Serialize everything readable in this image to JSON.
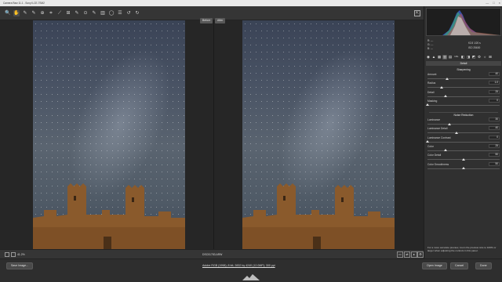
{
  "window": {
    "title": "Camera Raw 11.1  -  Sony ILCE-7SM2",
    "controls": [
      "—",
      "□",
      "×"
    ]
  },
  "toolbar": {
    "tools": [
      {
        "name": "zoom-tool",
        "glyph": "🔍",
        "active": false
      },
      {
        "name": "hand-tool",
        "glyph": "✋",
        "active": true
      },
      {
        "name": "white-balance-tool",
        "glyph": "✎",
        "active": false
      },
      {
        "name": "color-sampler-tool",
        "glyph": "✎",
        "active": false
      },
      {
        "name": "targeted-adjustment-tool",
        "glyph": "⊕",
        "active": false
      },
      {
        "name": "crop-tool",
        "glyph": "⌗",
        "active": false
      },
      {
        "name": "straighten-tool",
        "glyph": "⟋",
        "active": false
      },
      {
        "name": "transform-tool",
        "glyph": "⊞",
        "active": false
      },
      {
        "name": "spot-removal-tool",
        "glyph": "✎",
        "active": false
      },
      {
        "name": "red-eye-tool",
        "glyph": "⊙",
        "active": false
      },
      {
        "name": "adjustment-brush-tool",
        "glyph": "✎",
        "active": false
      },
      {
        "name": "graduated-filter-tool",
        "glyph": "▥",
        "active": false
      },
      {
        "name": "radial-filter-tool",
        "glyph": "◯",
        "active": false
      },
      {
        "name": "preferences-tool",
        "glyph": "☰",
        "active": false
      },
      {
        "name": "rotate-left-tool",
        "glyph": "↺",
        "active": false
      },
      {
        "name": "rotate-right-tool",
        "glyph": "↻",
        "active": false
      }
    ],
    "fullscreen_glyph": "⇱"
  },
  "compare": {
    "before_label": "Before",
    "after_label": "After"
  },
  "status": {
    "zoom": "41.2%",
    "filename": "DSC01783.ARW"
  },
  "footer": {
    "save_label": "Save Image...",
    "workflow": "Adobe RGB (1998); 8 bit; 2832 by 4240 (12.0MP); 300 ppi",
    "open_label": "Open Image",
    "cancel_label": "Cancel",
    "done_label": "Done"
  },
  "panel": {
    "rgb": {
      "r": "R:",
      "g": "G:",
      "b": "B:",
      "r_val": "---",
      "g_val": "---",
      "b_val": "---"
    },
    "info": {
      "line1": "f/2.8    1/20 s",
      "line2": "ISO 25600"
    },
    "tab_icons": [
      "◉",
      "▲",
      "▦",
      "▥",
      "▤",
      "HSL",
      "◧",
      "◨",
      "◩",
      "⚙",
      "☼",
      "⊞"
    ],
    "header": "Detail",
    "sharpening": {
      "title": "Sharpening",
      "rows": [
        {
          "label": "Amount",
          "value": "40",
          "pos": 0.27
        },
        {
          "label": "Radius",
          "value": "1.0",
          "pos": 0.2
        },
        {
          "label": "Detail",
          "value": "25",
          "pos": 0.25
        },
        {
          "label": "Masking",
          "value": "0",
          "pos": 0.0
        }
      ]
    },
    "noise": {
      "title": "Noise Reduction",
      "rows": [
        {
          "label": "Luminance",
          "value": "30",
          "pos": 0.3
        },
        {
          "label": "Luminance Detail",
          "value": "40",
          "pos": 0.4
        },
        {
          "label": "Luminance Contrast",
          "value": "0",
          "pos": 0.0
        },
        {
          "label": "Color",
          "value": "25",
          "pos": 0.25
        },
        {
          "label": "Color Detail",
          "value": "50",
          "pos": 0.5
        },
        {
          "label": "Color Smoothness",
          "value": "50",
          "pos": 0.5
        }
      ]
    },
    "tip": "For a more accurate preview, zoom the preview size to 100% or larger when adjusting the controls in this panel."
  }
}
